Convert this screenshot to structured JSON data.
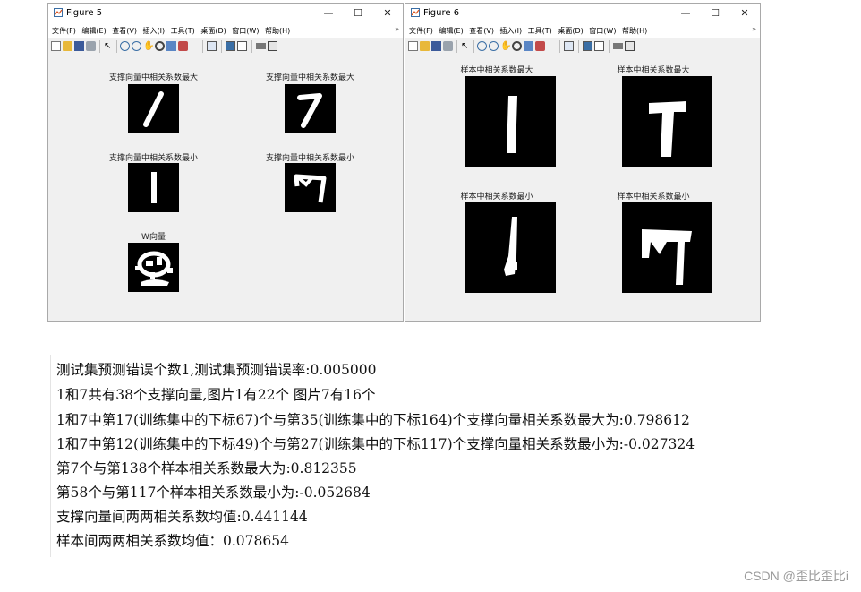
{
  "figure5": {
    "title": "Figure 5",
    "menu": [
      "文件(F)",
      "编辑(E)",
      "查看(V)",
      "插入(I)",
      "工具(T)",
      "桌面(D)",
      "窗口(W)",
      "帮助(H)"
    ],
    "plots": [
      {
        "title": "支撑向量中相关系数最大"
      },
      {
        "title": "支撑向量中相关系数最大"
      },
      {
        "title": "支撑向量中相关系数最小"
      },
      {
        "title": "支撑向量中相关系数最小"
      },
      {
        "title": "W向量"
      }
    ]
  },
  "figure6": {
    "title": "Figure 6",
    "menu": [
      "文件(F)",
      "编辑(E)",
      "查看(V)",
      "插入(I)",
      "工具(T)",
      "桌面(D)",
      "窗口(W)",
      "帮助(H)"
    ],
    "plots": [
      {
        "title": "样本中相关系数最大"
      },
      {
        "title": "样本中相关系数最大"
      },
      {
        "title": "样本中相关系数最小"
      },
      {
        "title": "样本中相关系数最小"
      }
    ]
  },
  "window_controls": {
    "minimize": "—",
    "maximize": "☐",
    "close": "✕"
  },
  "console": {
    "lines": [
      "测试集预测错误个数1,测试集预测错误率:0.005000",
      "1和7共有38个支撑向量,图片1有22个 图片7有16个",
      "1和7中第17(训练集中的下标67)个与第35(训练集中的下标164)个支撑向量相关系数最大为:0.798612",
      "1和7中第12(训练集中的下标49)个与第27(训练集中的下标117)个支撑向量相关系数最小为:-0.027324",
      "第7个与第138个样本相关系数最大为:0.812355",
      "第58个与第117个样本相关系数最小为:-0.052684",
      "支撑向量间两两相关系数均值:0.441144",
      "样本间两两相关系数均值：0.078654"
    ]
  },
  "watermark": "CSDN @歪比歪比i"
}
